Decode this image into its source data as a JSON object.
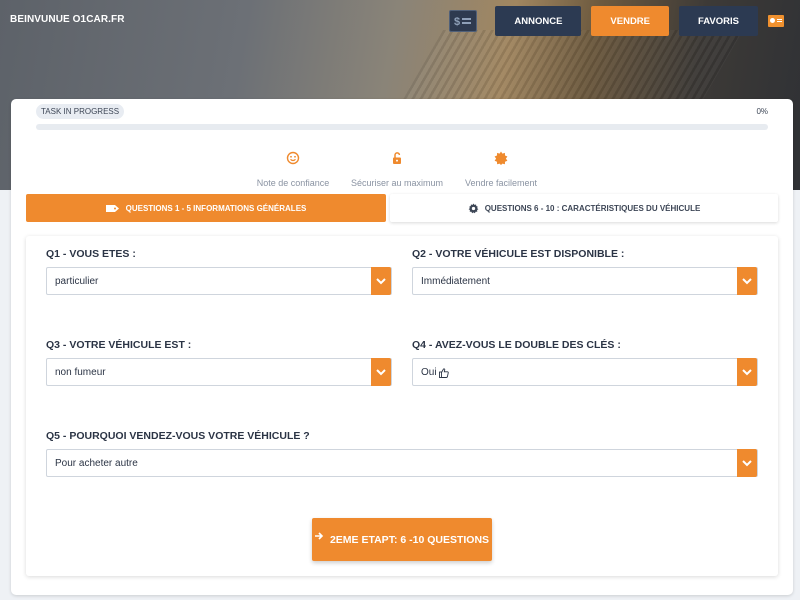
{
  "header": {
    "brand": "BEINVUNUE O1CAR.FR",
    "nav": {
      "annonce": "ANNONCE",
      "vendre": "VENDRE",
      "favoris": "FAVORIS"
    },
    "icons": [
      "money-icon",
      "id-card-icon"
    ]
  },
  "progress": {
    "badge": "TASK IN PROGRESS",
    "percent_label": "0%",
    "value": 0
  },
  "features": [
    {
      "icon": "smile-icon",
      "label": "Note de confiance"
    },
    {
      "icon": "unlock-icon",
      "label": "Sécuriser au maximum"
    },
    {
      "icon": "badge-icon",
      "label": "Vendre facilement"
    }
  ],
  "tabs": [
    {
      "icon": "tag-icon",
      "label": "QUESTIONS 1 - 5 INFORMATIONS GÉNÉRALES",
      "active": true
    },
    {
      "icon": "gear-icon",
      "label": "QUESTIONS 6 - 10 : CARACTÉRISTIQUES DU VÉHICULE",
      "active": false
    }
  ],
  "questions": [
    {
      "label": "Q1 - VOUS ETES :",
      "value": "particulier"
    },
    {
      "label": "Q2 - VOTRE VÉHICULE EST DISPONIBLE :",
      "value": "Immédiatement"
    },
    {
      "label": "Q3 - VOTRE VÉHICULE EST :",
      "value": "non fumeur"
    },
    {
      "label": "Q4 - AVEZ-VOUS LE DOUBLE DES CLÉS :",
      "value": "Oui"
    },
    {
      "label": "Q5 - POURQUOI VENDEZ-VOUS VOTRE VÉHICULE ?",
      "value": "Pour acheter autre"
    }
  ],
  "submit_label": "2EME ETAPT: 6 -10 QUESTIONS",
  "colors": {
    "accent": "#ef8a2e",
    "dark": "#2c3a52"
  }
}
